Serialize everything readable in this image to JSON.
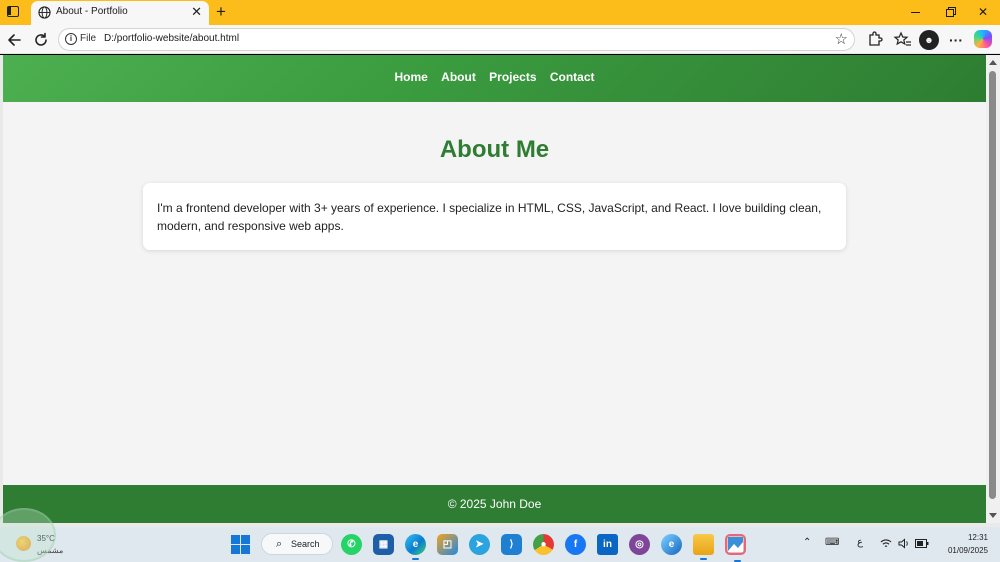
{
  "browser": {
    "tab_title": "About - Portfolio",
    "new_tab_symbol": "+",
    "close_symbol": "✕",
    "site_info_label": "File",
    "url": "D:/portfolio-website/about.html"
  },
  "page": {
    "nav": [
      "Home",
      "About",
      "Projects",
      "Contact"
    ],
    "heading": "About Me",
    "about_text": "I'm a frontend developer with 3+ years of experience. I specialize in HTML, CSS, JavaScript, and React. I love building clean, modern, and responsive web apps.",
    "footer": "© 2025 John Doe",
    "colors": {
      "header_start": "#4caf50",
      "header_end": "#2e7d32",
      "heading": "#2e7d32",
      "footer_bg": "#2e7d32",
      "body_bg": "#f4f4f4"
    }
  },
  "taskbar": {
    "weather_temp": "35°C",
    "weather_desc": "مشمس",
    "search_label": "Search",
    "language": "ع",
    "time": "12:31",
    "date": "01/09/2025"
  },
  "icons": {
    "titlebar": [
      "tab-actions-icon",
      "globe-icon",
      "close-icon",
      "plus-icon",
      "minimize-icon",
      "maximize-icon",
      "close-icon"
    ],
    "toolbar": [
      "back-arrow-icon",
      "reload-icon",
      "info-icon",
      "star-icon",
      "extensions-icon",
      "favorites-icon",
      "profile-icon",
      "more-icon",
      "copilot-icon"
    ],
    "taskbar_apps": [
      "windows-start-icon",
      "whatsapp-icon",
      "microsoft-store-icon",
      "edge-icon",
      "office-icon",
      "telegram-icon",
      "vscode-icon",
      "chrome-icon",
      "facebook-icon",
      "linkedin-icon",
      "tor-icon",
      "edge-dev-icon",
      "file-explorer-icon",
      "photos-icon"
    ],
    "tray": [
      "chevron-up-icon",
      "keyboard-icon",
      "wifi-icon",
      "volume-icon",
      "battery-icon"
    ]
  }
}
